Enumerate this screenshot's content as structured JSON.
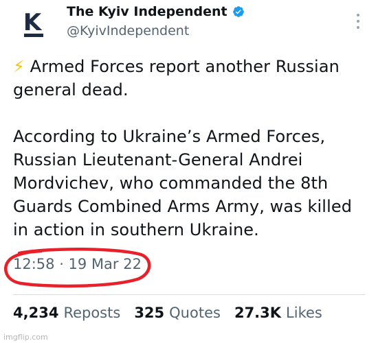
{
  "account": {
    "display_name": "The Kyiv Independent",
    "handle": "@KyivIndependent",
    "avatar_letter": "K",
    "verified": true,
    "verified_color": "#1d9bf0",
    "brand_color": "#1d2b45"
  },
  "tweet": {
    "emoji": "⚡",
    "headline": " Armed Forces report another Russian general dead.",
    "body": "According to Ukraine’s Armed Forces, Russian Lieutenant-General Andrei Mordvichev, who commanded the 8th Guards Combined Arms Army, was killed in action in southern Ukraine.",
    "timestamp": "12:58 · 19 Mar 22"
  },
  "stats": {
    "reposts_count": "4,234",
    "reposts_label": "Reposts",
    "quotes_count": "325",
    "quotes_label": "Quotes",
    "likes_count": "27.3K",
    "likes_label": "Likes"
  },
  "annotation_color": "#e8202a",
  "watermark": "imgflip.com"
}
